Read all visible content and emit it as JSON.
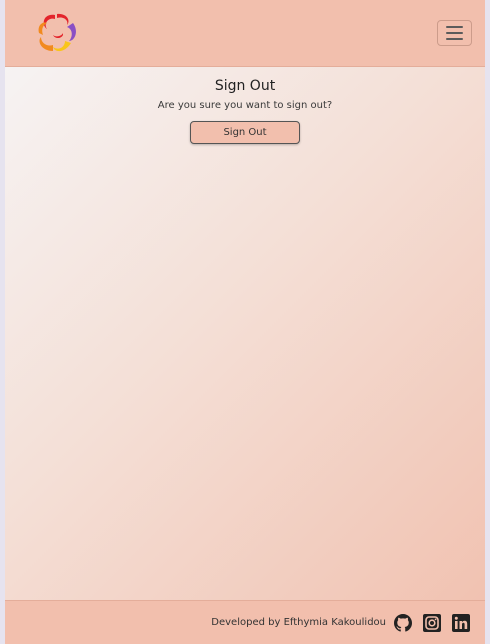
{
  "page": {
    "title": "Sign Out",
    "message": "Are you sure you want to sign out?",
    "signout_label": "Sign Out"
  },
  "navbar": {
    "logo_icon": "swirl-logo-icon",
    "menu_icon": "hamburger-menu-icon"
  },
  "footer": {
    "credit": "Developed by Efthymia Kakoulidou",
    "links": [
      {
        "icon": "github-icon"
      },
      {
        "icon": "instagram-icon"
      },
      {
        "icon": "linkedin-icon"
      }
    ]
  },
  "colors": {
    "brand": "#f2bfad",
    "gradient_start": "#f6f3f3",
    "gradient_end": "#f1c2b1",
    "logo_red": "#e3242b",
    "logo_purple": "#8a4fc4",
    "logo_orange": "#f28a1e",
    "logo_yellow": "#f9c51a"
  }
}
